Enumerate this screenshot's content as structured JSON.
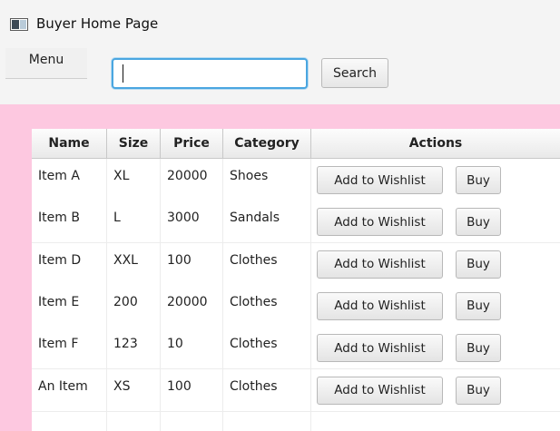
{
  "window": {
    "title": "Buyer Home Page"
  },
  "toolbar": {
    "menu_label": "Menu",
    "search_value": "",
    "search_label": "Search"
  },
  "table": {
    "columns": [
      "Name",
      "Size",
      "Price",
      "Category",
      "Actions"
    ],
    "rows": [
      {
        "name": "Item A",
        "size": "XL",
        "price": "20000",
        "category": "Shoes",
        "wishlist_label": "Add to Wishlist",
        "buy_label": "Buy"
      },
      {
        "name": "Item B",
        "size": "L",
        "price": "3000",
        "category": "Sandals",
        "wishlist_label": "Add to Wishlist",
        "buy_label": "Buy"
      },
      {
        "name": "Item D",
        "size": "XXL",
        "price": "100",
        "category": "Clothes",
        "wishlist_label": "Add to Wishlist",
        "buy_label": "Buy"
      },
      {
        "name": "Item E",
        "size": "200",
        "price": "20000",
        "category": "Clothes",
        "wishlist_label": "Add to Wishlist",
        "buy_label": "Buy"
      },
      {
        "name": "Item F",
        "size": "123",
        "price": "10",
        "category": "Clothes",
        "wishlist_label": "Add to Wishlist",
        "buy_label": "Buy"
      },
      {
        "name": "An Item",
        "size": "XS",
        "price": "100",
        "category": "Clothes",
        "wishlist_label": "Add to Wishlist",
        "buy_label": "Buy"
      }
    ]
  },
  "colors": {
    "content_background": "#fdc8e0",
    "focus_ring": "#4aa6e0"
  }
}
